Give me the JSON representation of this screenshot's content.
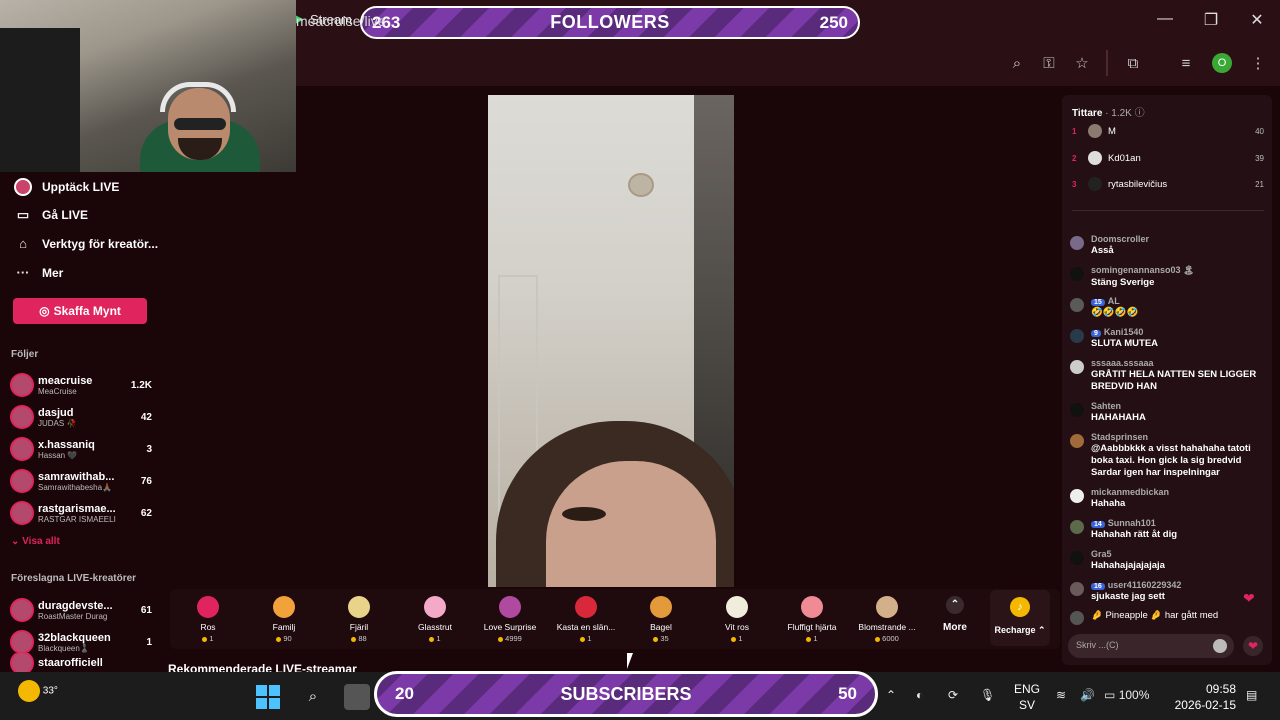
{
  "browser": {
    "tab_title": "Stream",
    "url": "meacruise/live",
    "profile_initial": "O",
    "window_controls": [
      "minimize",
      "maximize",
      "close"
    ]
  },
  "overlay_followers": {
    "left": "263",
    "label": "FOLLOWERS",
    "right": "250"
  },
  "overlay_subscribers": {
    "left": "20",
    "label": "SUBSCRIBERS",
    "right": "50"
  },
  "sidebar": {
    "nav": [
      {
        "label": "Upptäck LIVE",
        "icon": "live-avatar-icon"
      },
      {
        "label": "Gå LIVE",
        "icon": "video-camera-icon"
      },
      {
        "label": "Verktyg för kreatör...",
        "icon": "home-icon"
      },
      {
        "label": "Mer",
        "icon": "more-dots-icon"
      }
    ],
    "cta_label": "Skaffa Mynt",
    "following_title": "Följer",
    "following": [
      {
        "name": "meacruise",
        "sub": "MeaCruise",
        "count": "1.2K"
      },
      {
        "name": "dasjud",
        "sub": "JUDAS 🥀",
        "count": "42"
      },
      {
        "name": "x.hassaniq",
        "sub": "Hassan 🖤",
        "count": "3"
      },
      {
        "name": "samrawithab...",
        "sub": "Samrawithabesha🙏🏾",
        "count": "76"
      },
      {
        "name": "rastgarismae...",
        "sub": "RASTGAR ISMAEELI",
        "count": "62"
      }
    ],
    "show_all": "Visa allt",
    "suggested_title": "Föreslagna LIVE-kreatörer",
    "suggested": [
      {
        "name": "duragdevste...",
        "sub": "RoastMaster Durag",
        "count": "61"
      },
      {
        "name": "32blackqueen",
        "sub": "Blackqueen♟️",
        "count": "1"
      },
      {
        "name": "staarofficiell",
        "sub": "",
        "count": ""
      }
    ]
  },
  "gifts": [
    {
      "name": "Ros",
      "price": "1",
      "color": "#e0245e"
    },
    {
      "name": "Familj",
      "price": "90",
      "color": "#f2a23a"
    },
    {
      "name": "Fjäril",
      "price": "88",
      "color": "#e9d38a"
    },
    {
      "name": "Glasstrut",
      "price": "1",
      "color": "#f5a9c8"
    },
    {
      "name": "Love Surprise",
      "price": "4999",
      "color": "#b04aa0"
    },
    {
      "name": "Kasta en slän...",
      "price": "1",
      "color": "#d8283a"
    },
    {
      "name": "Bagel",
      "price": "35",
      "color": "#e39a3a"
    },
    {
      "name": "Vit ros",
      "price": "1",
      "color": "#f0eddc"
    },
    {
      "name": "Fluffigt hjärta",
      "price": "1",
      "color": "#f08a94"
    },
    {
      "name": "Blomstrande ...",
      "price": "6000",
      "color": "#d4b08a"
    }
  ],
  "gift_more": "More",
  "recharge_label": "Recharge",
  "recommend_title": "Rekommenderade LIVE-streamar",
  "viewers": {
    "title": "Tittare",
    "count": "· 1.2K",
    "top": [
      {
        "rank": "1",
        "name": "M",
        "score": "40"
      },
      {
        "rank": "2",
        "name": "Kd01an",
        "score": "39"
      },
      {
        "rank": "3",
        "name": "rytasbilevičius",
        "score": "21"
      }
    ]
  },
  "chat": [
    {
      "user": "Doomscroller",
      "text": "Asså",
      "badge": ""
    },
    {
      "user": "somingenannanso03 🏝",
      "text": "Stäng Sverige",
      "badge": ""
    },
    {
      "user": "AL",
      "text": "🤣🤣🤣🤣",
      "badge": "15"
    },
    {
      "user": "Kani1540",
      "text": "SLUTA MUTEA",
      "badge": "9"
    },
    {
      "user": "sssaaa.sssaaa",
      "text": "GRÅTIT HELA NATTEN SEN LIGGER BREDVID HAN",
      "badge": ""
    },
    {
      "user": "Sahten",
      "text": "HAHAHAHA",
      "badge": ""
    },
    {
      "user": "Stadsprinsen",
      "text": "@Aabbbkkk a visst hahahaha tatoti boka taxi. Hon gick la sig bredvid Sardar igen har inspelningar",
      "badge": ""
    },
    {
      "user": "mickanmedbickan",
      "text": "Hahaha",
      "badge": ""
    },
    {
      "user": "Sunnah101",
      "text": "Hahahah rätt åt dig",
      "badge": "14"
    },
    {
      "user": "Gra5",
      "text": "Hahahajajajajaja",
      "badge": ""
    },
    {
      "user": "user41160229342",
      "text": "sjukaste jag sett",
      "badge": "16"
    }
  ],
  "pinned_msg": "🤌 Pineapple 🤌 har gått med",
  "chat_placeholder": "Skriv ...(C)",
  "taskbar": {
    "temperature": "33°",
    "lang_top": "ENG",
    "lang_bottom": "SV",
    "battery": "100%",
    "time": "09:58",
    "date": "2026-02-15"
  }
}
